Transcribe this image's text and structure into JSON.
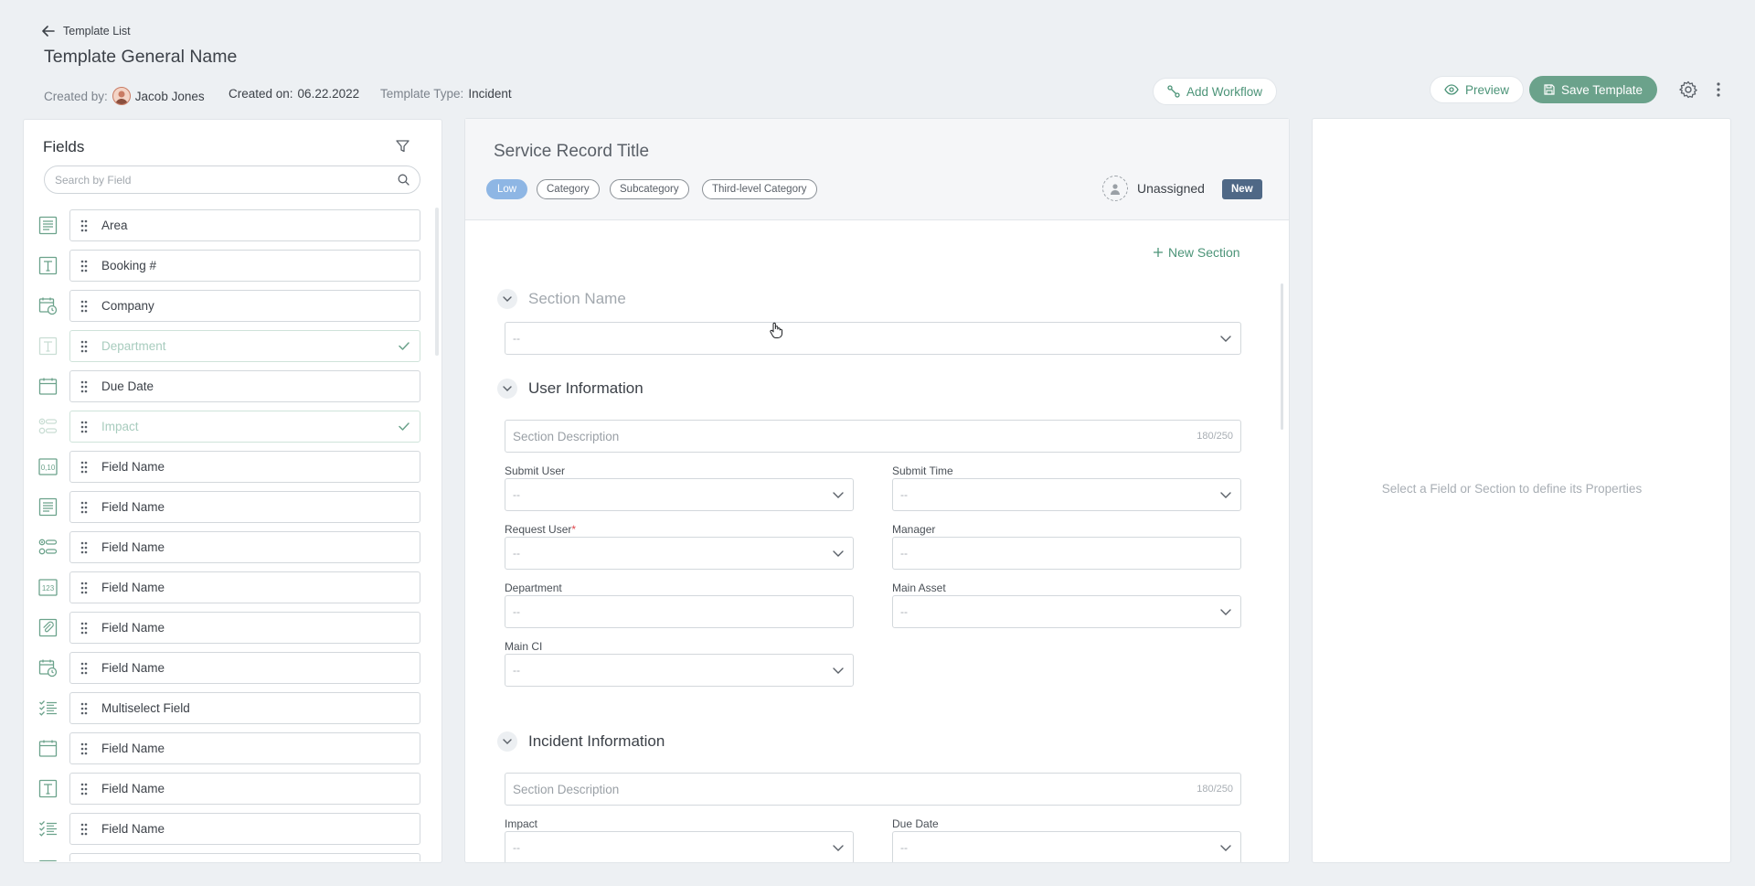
{
  "header": {
    "back_label": "Template List",
    "title": "Template General Name",
    "created_by_label": "Created by:",
    "created_by_name": "Jacob Jones",
    "created_on_label": "Created on:",
    "created_on_value": "06.22.2022",
    "template_type_label": "Template Type:",
    "template_type_value": "Incident",
    "add_workflow_label": "Add Workflow",
    "preview_label": "Preview",
    "save_label": "Save Template"
  },
  "fields_panel": {
    "title": "Fields",
    "search_placeholder": "Search by Field",
    "items": [
      {
        "label": "Area",
        "icon": "textarea-icon",
        "used": false
      },
      {
        "label": "Booking #",
        "icon": "text-field-icon",
        "used": false
      },
      {
        "label": "Company",
        "icon": "datetime-icon",
        "used": false
      },
      {
        "label": "Department",
        "icon": "text-field-icon",
        "used": true
      },
      {
        "label": "Due Date",
        "icon": "calendar-icon",
        "used": false
      },
      {
        "label": "Impact",
        "icon": "radio-list-icon",
        "used": true
      },
      {
        "label": "Field Name",
        "icon": "decimal-icon",
        "used": false
      },
      {
        "label": "Field Name",
        "icon": "textarea-icon",
        "used": false
      },
      {
        "label": "Field Name",
        "icon": "radio-list-icon",
        "used": false
      },
      {
        "label": "Field Name",
        "icon": "number-icon",
        "used": false
      },
      {
        "label": "Field Name",
        "icon": "attachment-icon",
        "used": false
      },
      {
        "label": "Field Name",
        "icon": "datetime-icon",
        "used": false
      },
      {
        "label": "Multiselect Field",
        "icon": "checklist-icon",
        "used": false
      },
      {
        "label": "Field Name",
        "icon": "calendar-icon",
        "used": false
      },
      {
        "label": "Field Name",
        "icon": "text-field-icon",
        "used": false
      },
      {
        "label": "Field Name",
        "icon": "checklist-icon",
        "used": false
      }
    ]
  },
  "record": {
    "title": "Service Record Title",
    "chips": [
      "Low",
      "Category",
      "Subcategory",
      "Third-level Category"
    ],
    "assignee": "Unassigned",
    "status": "New",
    "new_section_label": "New Section"
  },
  "sections": {
    "section_name": {
      "title": "Section Name",
      "select_value": "--"
    },
    "user_info": {
      "title": "User Information",
      "desc_placeholder": "Section Description",
      "desc_count": "180/250",
      "submit_user": {
        "label": "Submit User",
        "value": "--"
      },
      "submit_time": {
        "label": "Submit Time",
        "value": "--"
      },
      "request_user": {
        "label": "Request User",
        "required": "*",
        "value": "--"
      },
      "manager": {
        "label": "Manager",
        "value": "--"
      },
      "department": {
        "label": "Department",
        "value": "--"
      },
      "main_asset": {
        "label": "Main Asset",
        "value": "--"
      },
      "main_ci": {
        "label": "Main CI",
        "value": "--"
      }
    },
    "incident_info": {
      "title": "Incident Information",
      "desc_placeholder": "Section Description",
      "desc_count": "180/250",
      "impact": {
        "label": "Impact",
        "value": "--"
      },
      "due_date": {
        "label": "Due Date",
        "value": "--"
      }
    }
  },
  "properties_panel": {
    "empty_message": "Select a Field or Section to define its Properties"
  },
  "colors": {
    "accent_green": "#6ba28b",
    "low_chip": "#8eb6e4",
    "status_new": "#4f6886",
    "background": "#edf0f3"
  }
}
